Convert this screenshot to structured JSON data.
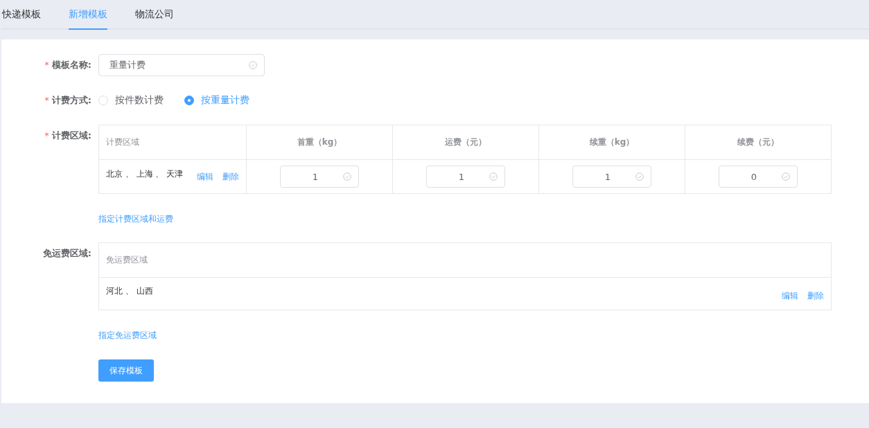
{
  "tabs": [
    {
      "label": "快递模板",
      "selected": false
    },
    {
      "label": "新增模板",
      "selected": true
    },
    {
      "label": "物流公司",
      "selected": false
    }
  ],
  "form": {
    "name_field": {
      "label": "模板名称:",
      "required_mark": "*",
      "value": "重量计费"
    },
    "billing_method": {
      "label": "计费方式:",
      "required_mark": "*",
      "options": [
        {
          "label": "按件数计费",
          "selected": false
        },
        {
          "label": "按重量计费",
          "selected": true
        }
      ]
    },
    "billing_region": {
      "label": "计费区域:",
      "required_mark": "*",
      "columns": [
        "计费区域",
        "首重（kg）",
        "运费（元）",
        "续重（kg）",
        "续费（元）"
      ],
      "rows": [
        {
          "regions": "北京 、 上海 、 天津",
          "actions": [
            "编辑",
            "删除"
          ],
          "values": [
            "1",
            "1",
            "1",
            "0"
          ]
        }
      ],
      "add_link": "指定计费区域和运费"
    },
    "free_region": {
      "label": "免运费区域:",
      "column": "免运费区域",
      "rows": [
        {
          "regions": "河北 、 山西",
          "actions": [
            "编辑",
            "删除"
          ]
        }
      ],
      "add_link": "指定免运费区域"
    },
    "save_button": "保存模板"
  }
}
